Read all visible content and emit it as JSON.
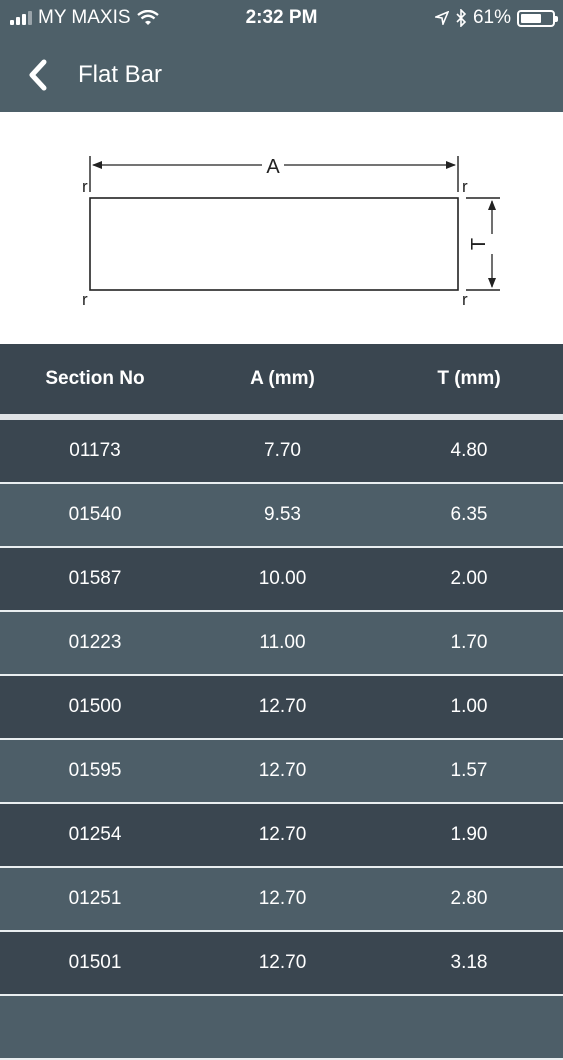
{
  "status": {
    "carrier": "MY MAXIS",
    "time": "2:32 PM",
    "battery": "61%"
  },
  "header": {
    "title": "Flat Bar"
  },
  "diagram": {
    "dim_a": "A",
    "dim_t": "T",
    "corner": "r"
  },
  "table": {
    "columns": [
      "Section No",
      "A (mm)",
      "T (mm)"
    ],
    "rows": [
      [
        "01173",
        "7.70",
        "4.80"
      ],
      [
        "01540",
        "9.53",
        "6.35"
      ],
      [
        "01587",
        "10.00",
        "2.00"
      ],
      [
        "01223",
        "11.00",
        "1.70"
      ],
      [
        "01500",
        "12.70",
        "1.00"
      ],
      [
        "01595",
        "12.70",
        "1.57"
      ],
      [
        "01254",
        "12.70",
        "1.90"
      ],
      [
        "01251",
        "12.70",
        "2.80"
      ],
      [
        "01501",
        "12.70",
        "3.18"
      ]
    ]
  }
}
